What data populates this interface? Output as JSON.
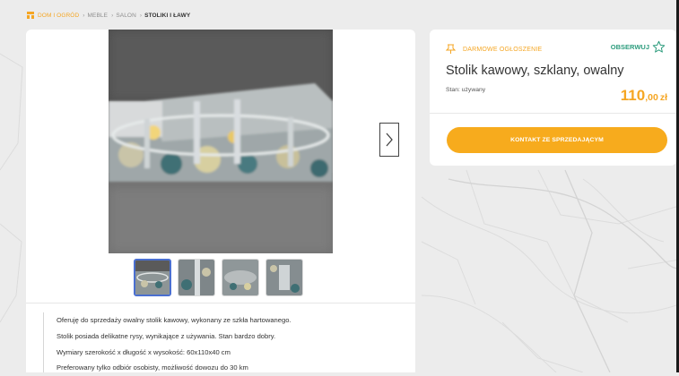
{
  "breadcrumb": {
    "items": [
      {
        "label": "DOM I OGRÓD"
      },
      {
        "label": "MEBLE"
      },
      {
        "label": "SALON"
      },
      {
        "label": "STOLIKI I ŁAWY"
      }
    ],
    "separator": "›"
  },
  "gallery": {
    "next_icon": "chevron-right-icon",
    "thumbnail_count": 4,
    "active_thumbnail": 1
  },
  "description": {
    "lines": [
      "Oferuję do sprzedaży owalny stolik kawowy, wykonany ze szkła hartowanego.",
      "Stolik posiada delikatne rysy, wynikające z używania. Stan bardzo dobry.",
      "Wymiary szerokość x długość x wysokość: 60x110x40 cm",
      "Preferowany tylko odbiór osobisty, możliwość dowozu do 30 km"
    ]
  },
  "offer": {
    "badge": "DARMOWE OGŁOSZENIE",
    "observe_label": "OBSERWUJ",
    "title": "Stolik kawowy, szklany, owalny",
    "condition": "Stan: używany",
    "price_main": "110",
    "price_decimal": ",00",
    "currency": "zł",
    "contact_button": "KONTAKT ZE SPRZEDAJĄCYM"
  },
  "colors": {
    "accent": "#f5a623",
    "observe": "#2d9c7d",
    "button": "#f7ab1d"
  }
}
